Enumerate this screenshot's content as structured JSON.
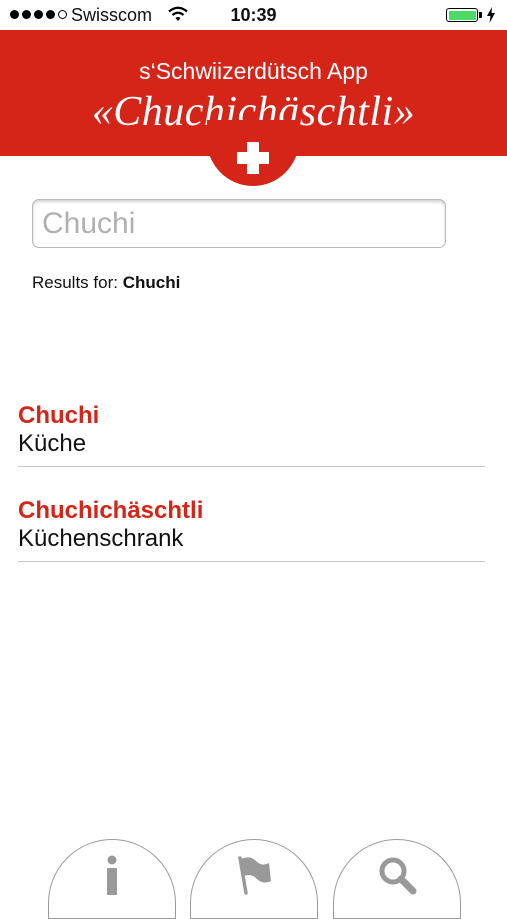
{
  "status_bar": {
    "carrier": "Swisscom",
    "time": "10:39",
    "battery_level": 1.0
  },
  "header": {
    "subtitle": "s‘Schwiizerdütsch App",
    "title": "«Chuchichäschtli»"
  },
  "search": {
    "value": "Chuchi"
  },
  "results": {
    "prefix": "Results for:",
    "query": "Chuchi"
  },
  "entries": [
    {
      "word": "Chuchi",
      "translation": "Küche"
    },
    {
      "word": "Chuchichäschtli",
      "translation": "Küchenschrank"
    }
  ],
  "tabs": [
    {
      "icon": "info-icon"
    },
    {
      "icon": "flag-icon"
    },
    {
      "icon": "search-icon"
    }
  ],
  "colors": {
    "brand_red": "#d52519",
    "battery_green": "#4cd964",
    "divider": "#c8c8c8"
  }
}
